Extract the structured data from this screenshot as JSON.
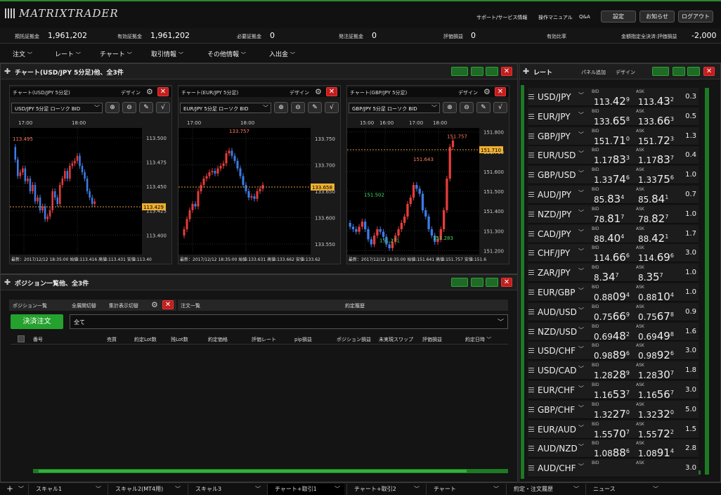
{
  "app": {
    "logo": "MATRIXTRADER",
    "links": [
      "サポート/サービス情報",
      "操作マニュアル",
      "Q&A"
    ],
    "buttons": [
      "設定",
      "お知らせ",
      "ログアウト"
    ]
  },
  "account": [
    {
      "label": "預託証拠金",
      "value": "1,961,202"
    },
    {
      "label": "有効証拠金",
      "value": "1,961,202"
    },
    {
      "label": "必要証拠金",
      "value": "0"
    },
    {
      "label": "発注証拠金",
      "value": "0"
    },
    {
      "label": "評価損益",
      "value": "0"
    },
    {
      "label": "有効比率",
      "value": ""
    },
    {
      "label": "金額指定全決済:評価損益",
      "value": "-2,000"
    }
  ],
  "menu": [
    "注文",
    "レート",
    "チャート",
    "取引情報",
    "その他情報",
    "入出金"
  ],
  "chart_panel": {
    "title": "チャート(USD/JPY 5分足)他、全3件"
  },
  "charts": [
    {
      "title": "チャート(USD/JPY 5分足)",
      "design": "デザイン",
      "select": "USD/JPY 5分足 ローソク BID",
      "footer": "最新：2017/12/12 18:35:00 始値:113.416 高値:113.431 安値:113.40",
      "times": [
        "17:00",
        "18:00"
      ],
      "yticks": [
        "113.500",
        "113.475",
        "113.450",
        "113.425",
        "113.400"
      ],
      "current": "113.429",
      "marks": [
        "113.495"
      ]
    },
    {
      "title": "チャート(EUR/JPY 5分足)",
      "design": "デザイン",
      "select": "EUR/JPY 5分足 ローソク BID",
      "footer": "最新：2017/12/12 18:35:00 始値:133.631 高値:133.662 安値:133.62",
      "times": [
        "17:00",
        "18:00"
      ],
      "yticks": [
        "133.750",
        "133.700",
        "133.650",
        "133.600",
        "133.550"
      ],
      "current": "133.658",
      "marks": [
        "133.757"
      ]
    },
    {
      "title": "チャート(GBP/JPY 5分足)",
      "design": "デザイン",
      "select": "GBP/JPY 5分足 ローソク BID",
      "footer": "最新：2017/12/12 18:35:00 始値:151.641 高値:151.757 安値:151.6",
      "times": [
        "15:00",
        "16:00",
        "17:00",
        "18:00"
      ],
      "yticks": [
        "151.800",
        "151.700",
        "151.600",
        "151.500",
        "151.400",
        "151.300",
        "151.200"
      ],
      "current": "151.710",
      "marks": [
        "151.757",
        "151.643",
        "151.502",
        "151.283",
        "151.271"
      ]
    }
  ],
  "chart_data": [
    {
      "type": "candlestick",
      "title": "チャート(USD/JPY 5分足)",
      "ylim": [
        113.38,
        113.51
      ],
      "y": [
        113.5,
        113.475,
        113.45,
        113.425,
        113.4
      ],
      "x": [
        "17:00",
        "18:00"
      ],
      "current": 113.429,
      "high_label": 113.495
    },
    {
      "type": "candlestick",
      "title": "チャート(EUR/JPY 5分足)",
      "ylim": [
        133.53,
        133.77
      ],
      "y": [
        133.75,
        133.7,
        133.65,
        133.6,
        133.55
      ],
      "x": [
        "17:00",
        "18:00"
      ],
      "current": 133.658,
      "high_label": 133.757
    },
    {
      "type": "candlestick",
      "title": "チャート(GBP/JPY 5分足)",
      "ylim": [
        151.18,
        151.82
      ],
      "y": [
        151.8,
        151.7,
        151.6,
        151.5,
        151.4,
        151.3,
        151.2
      ],
      "x": [
        "15:00",
        "16:00",
        "17:00",
        "18:00"
      ],
      "current": 151.71,
      "labels": [
        151.757,
        151.643,
        151.502,
        151.283,
        151.271
      ]
    }
  ],
  "position_panel": {
    "title": "ポジション一覧他、全3件",
    "tab1": "ポジション一覧",
    "expand": "全展開切替",
    "summary": "集計表示切替",
    "tab2": "注文一覧",
    "tab3": "約定履歴",
    "settle": "決済注文",
    "filter": "全て",
    "columns": [
      "番号",
      "売買",
      "約定Lot数",
      "残Lot数",
      "約定価格",
      "評価レート",
      "pip損益",
      "ポジション損益",
      "未実現スワップ",
      "評価損益",
      "約定日時"
    ]
  },
  "rate_panel": {
    "title": "レート",
    "add": "パネル追加",
    "design": "デザイン",
    "bid": "BID",
    "ask": "ASK"
  },
  "rates": [
    {
      "sym": "USD/JPY",
      "bp": "113.",
      "bb": "42",
      "bs": "9",
      "ap": "113.",
      "ab": "43",
      "as": "2",
      "sp": "0.3"
    },
    {
      "sym": "EUR/JPY",
      "bp": "133.",
      "bb": "65",
      "bs": "8",
      "ap": "133.",
      "ab": "66",
      "as": "3",
      "sp": "0.5"
    },
    {
      "sym": "GBP/JPY",
      "bp": "151.",
      "bb": "71",
      "bs": "0",
      "ap": "151.",
      "ab": "72",
      "as": "3",
      "sp": "1.3"
    },
    {
      "sym": "EUR/USD",
      "bp": "1.17",
      "bb": "83",
      "bs": "3",
      "ap": "1.17",
      "ab": "83",
      "as": "7",
      "sp": "0.4"
    },
    {
      "sym": "GBP/USD",
      "bp": "1.33",
      "bb": "74",
      "bs": "6",
      "ap": "1.33",
      "ab": "75",
      "as": "6",
      "sp": "1.0"
    },
    {
      "sym": "AUD/JPY",
      "bp": "85.",
      "bb": "83",
      "bs": "4",
      "ap": "85.",
      "ab": "84",
      "as": "1",
      "sp": "0.7"
    },
    {
      "sym": "NZD/JPY",
      "bp": "78.",
      "bb": "81",
      "bs": "7",
      "ap": "78.",
      "ab": "82",
      "as": "7",
      "sp": "1.0"
    },
    {
      "sym": "CAD/JPY",
      "bp": "88.",
      "bb": "40",
      "bs": "4",
      "ap": "88.",
      "ab": "42",
      "as": "1",
      "sp": "1.7"
    },
    {
      "sym": "CHF/JPY",
      "bp": "114.",
      "bb": "66",
      "bs": "6",
      "ap": "114.",
      "ab": "69",
      "as": "6",
      "sp": "3.0"
    },
    {
      "sym": "ZAR/JPY",
      "bp": "8.",
      "bb": "34",
      "bs": "7",
      "ap": "8.",
      "ab": "35",
      "as": "7",
      "sp": "1.0"
    },
    {
      "sym": "EUR/GBP",
      "bp": "0.88",
      "bb": "09",
      "bs": "4",
      "ap": "0.88",
      "ab": "10",
      "as": "4",
      "sp": "1.0"
    },
    {
      "sym": "AUD/USD",
      "bp": "0.75",
      "bb": "66",
      "bs": "9",
      "ap": "0.75",
      "ab": "67",
      "as": "8",
      "sp": "0.9"
    },
    {
      "sym": "NZD/USD",
      "bp": "0.69",
      "bb": "48",
      "bs": "2",
      "ap": "0.69",
      "ab": "49",
      "as": "8",
      "sp": "1.6"
    },
    {
      "sym": "USD/CHF",
      "bp": "0.98",
      "bb": "89",
      "bs": "6",
      "ap": "0.98",
      "ab": "92",
      "as": "6",
      "sp": "3.0"
    },
    {
      "sym": "USD/CAD",
      "bp": "1.28",
      "bb": "28",
      "bs": "9",
      "ap": "1.28",
      "ab": "30",
      "as": "7",
      "sp": "1.8"
    },
    {
      "sym": "EUR/CHF",
      "bp": "1.16",
      "bb": "53",
      "bs": "7",
      "ap": "1.16",
      "ab": "56",
      "as": "7",
      "sp": "3.0"
    },
    {
      "sym": "GBP/CHF",
      "bp": "1.32",
      "bb": "27",
      "bs": "0",
      "ap": "1.32",
      "ab": "32",
      "as": "0",
      "sp": "5.0"
    },
    {
      "sym": "EUR/AUD",
      "bp": "1.55",
      "bb": "70",
      "bs": "7",
      "ap": "1.55",
      "ab": "72",
      "as": "2",
      "sp": "1.5"
    },
    {
      "sym": "AUD/NZD",
      "bp": "1.08",
      "bb": "88",
      "bs": "6",
      "ap": "1.08",
      "ab": "91",
      "as": "4",
      "sp": "2.8"
    },
    {
      "sym": "AUD/CHF",
      "bp": "",
      "bb": "",
      "bs": "",
      "ap": "",
      "ab": "",
      "as": "",
      "sp": "3.0"
    }
  ],
  "tabs": [
    "スキャル1",
    "スキャル2(MT4用)",
    "スキャル3",
    "チャート+取引1",
    "チャート+取引2",
    "チャート",
    "約定・注文履歴",
    "ニュース"
  ]
}
